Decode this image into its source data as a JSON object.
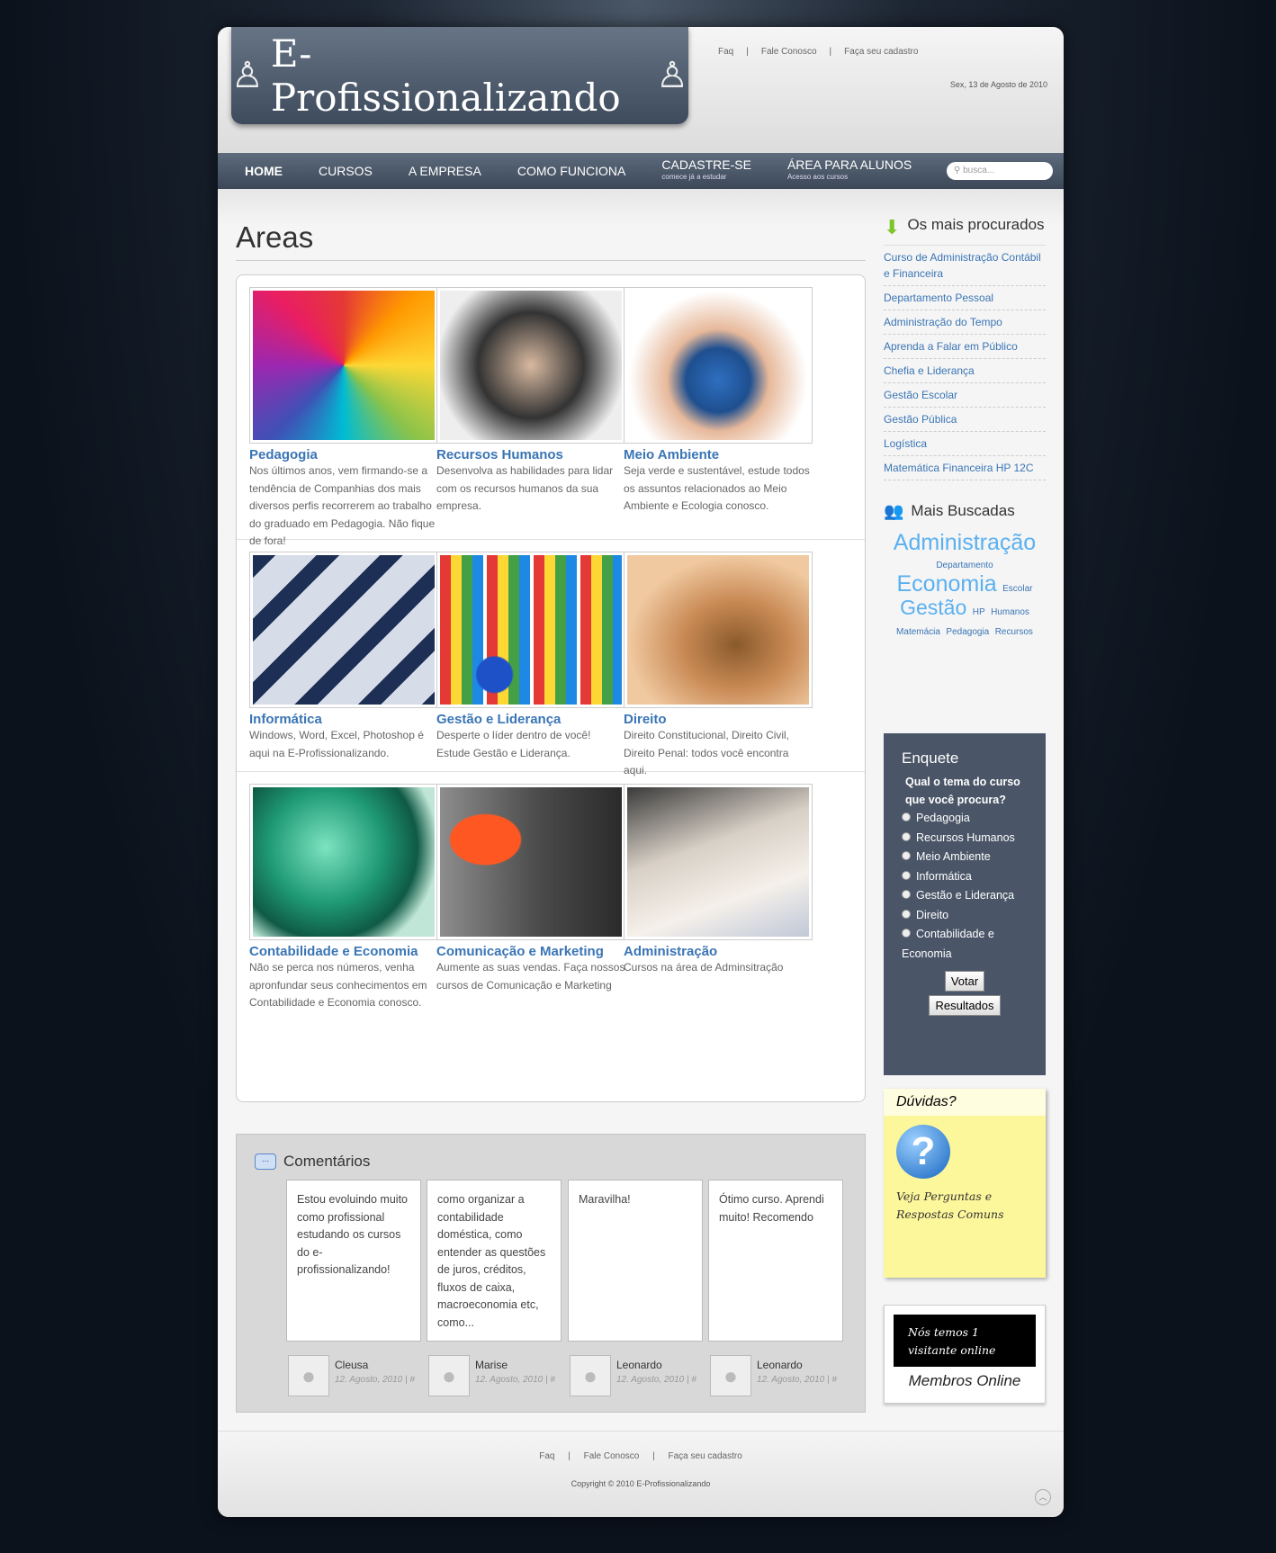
{
  "header": {
    "logo_text": "E- Profissionalizando",
    "date": "Sex, 13 de Agosto de 2010",
    "top_links": [
      "Faq",
      "Fale Conosco",
      "Faça seu cadastro"
    ]
  },
  "nav": {
    "items": [
      {
        "label": "HOME"
      },
      {
        "label": "CURSOS"
      },
      {
        "label": "A EMPRESA"
      },
      {
        "label": "COMO FUNCIONA"
      },
      {
        "label": "CADASTRE-SE",
        "sub": "comece já a estudar"
      },
      {
        "label": "ÁREA PARA ALUNOS",
        "sub": "Acesso aos cursos"
      }
    ],
    "search_placeholder": "busca..."
  },
  "main": {
    "title": "Areas",
    "areas": [
      {
        "title": "Pedagogia",
        "text": "Nos últimos anos, vem firmando-se a tendência de Companhias dos mais diversos perfis recorrerem ao trabalho do graduado em Pedagogia. Não fique de fora!"
      },
      {
        "title": "Recursos Humanos",
        "text": "Desenvolva as habilidades para lidar com os recursos humanos da sua empresa."
      },
      {
        "title": "Meio Ambiente",
        "text": "Seja verde e sustentável, estude todos os assuntos relacionados ao Meio Ambiente e Ecologia conosco."
      },
      {
        "title": "Informática",
        "text": "Windows, Word, Excel, Photoshop é aqui na E-Profissionalizando."
      },
      {
        "title": "Gestão e Liderança",
        "text": "Desperte o líder dentro de você! Estude Gestão e Liderança."
      },
      {
        "title": "Direito",
        "text": "Direito Constitucional, Direito Civil, Direito Penal: todos você encontra aqui."
      },
      {
        "title": "Contabilidade e Economia",
        "text": "Não se perca nos números, venha apronfundar seus conhecimentos em Contabilidade e Economia conosco."
      },
      {
        "title": "Comunicação e Marketing",
        "text": "Aumente as suas vendas. Faça nossos cursos de Comunicação e Marketing"
      },
      {
        "title": "Administração",
        "text": "Cursos na área de Adminsitração"
      }
    ]
  },
  "comments": {
    "title": "Comentários",
    "items": [
      {
        "text": "Estou evoluindo muito como profissional estudando os cursos do e-profissionalizando!",
        "author": "Cleusa",
        "date": "12. Agosto, 2010 | #"
      },
      {
        "text": "como organizar a contabilidade doméstica, como entender as questões de juros, créditos, fluxos de caixa, macroeconomia etc, como...",
        "author": "Marise",
        "date": "12. Agosto, 2010 | #"
      },
      {
        "text": "Maravilha!",
        "author": "Leonardo",
        "date": "12. Agosto, 2010 | #"
      },
      {
        "text": "Ótimo curso. Aprendi muito! Recomendo",
        "author": "Leonardo",
        "date": "12. Agosto, 2010 | #"
      }
    ]
  },
  "sidebar": {
    "most_title": "Os mais procurados",
    "most": [
      "Curso de Administração Contábil e Financeira",
      "Departamento Pessoal",
      "Administração do Tempo",
      "Aprenda a Falar em Público",
      "Chefia e Liderança",
      "Gestão Escolar",
      "Gestão Pública",
      "Logística",
      "Matemática Financeira HP 12C"
    ],
    "searched_title": "Mais Buscadas",
    "tags": [
      {
        "t": "Administração",
        "s": 25
      },
      {
        "t": "Departamento",
        "s": 10
      },
      {
        "t": "Economia",
        "s": 25
      },
      {
        "t": "Escolar",
        "s": 10
      },
      {
        "t": "Gestão",
        "s": 23
      },
      {
        "t": "HP",
        "s": 10
      },
      {
        "t": "Humanos",
        "s": 10
      },
      {
        "t": "Matemácia",
        "s": 10
      },
      {
        "t": "Pedagogia",
        "s": 10
      },
      {
        "t": "Recursos",
        "s": 10
      }
    ],
    "poll": {
      "title": "Enquete",
      "question": "Qual o tema do curso que você procura?",
      "options": [
        "Pedagogia",
        "Recursos Humanos",
        "Meio Ambiente",
        "Informática",
        "Gestão e Liderança",
        "Direito",
        "Contabilidade e Economia"
      ],
      "vote": "Votar",
      "results": "Resultados"
    },
    "duvidas": {
      "title": "Dúvidas?",
      "text": "Veja Perguntas e Respostas Comuns"
    },
    "online": {
      "text": "Nós temos 1 visitante online",
      "label": "Membros Online"
    }
  },
  "footer": {
    "links": [
      "Faq",
      "Fale Conosco",
      "Faça seu cadastro"
    ],
    "copyright": "Copyright © 2010 E-Profissionalizando"
  }
}
